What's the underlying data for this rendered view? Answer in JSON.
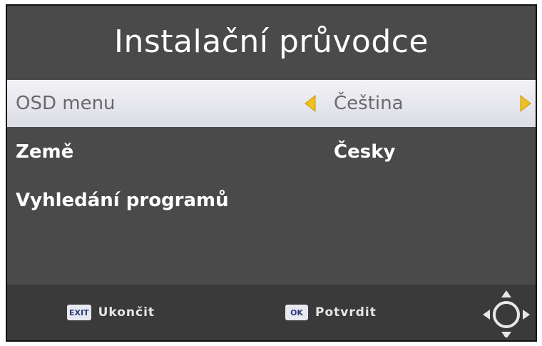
{
  "title": "Instalační průvodce",
  "menu": [
    {
      "label": "OSD menu",
      "value": "Čeština",
      "selected": true
    },
    {
      "label": "Země",
      "value": "Česky",
      "selected": false
    },
    {
      "label": "Vyhledání programů",
      "value": "",
      "selected": false
    }
  ],
  "footer": {
    "exit_key": "EXIT",
    "exit_label": "Ukončit",
    "ok_key": "OK",
    "ok_label": "Potvrdit"
  },
  "colors": {
    "arrow": "#f0c020",
    "background": "#4a4a4a",
    "highlight": "#e6e6ee"
  },
  "icons": [
    "arrow-left-icon",
    "arrow-right-icon",
    "dpad-icon"
  ]
}
